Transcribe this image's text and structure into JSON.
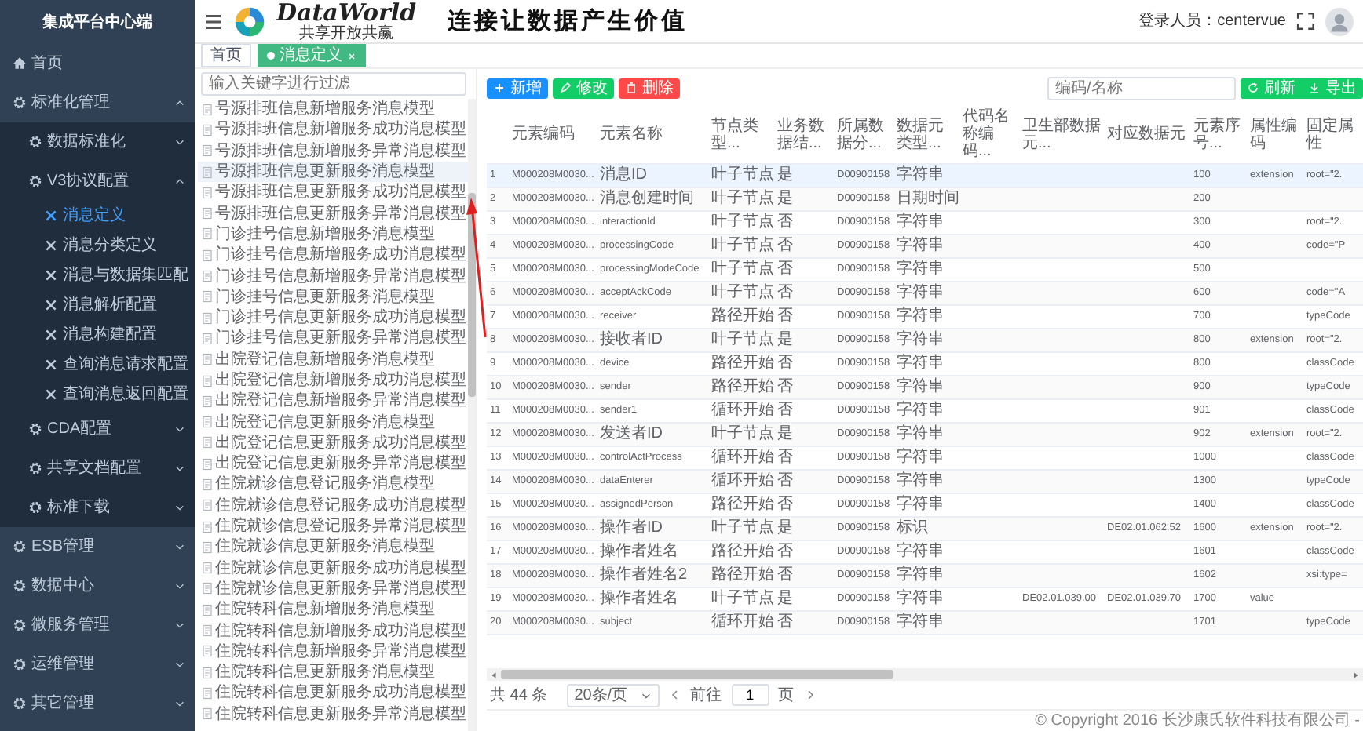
{
  "sidebar": {
    "title": "集成平台中心端",
    "items": [
      {
        "label": "首页",
        "kind": "link"
      },
      {
        "label": "标准化管理",
        "kind": "menu",
        "expanded": true,
        "children": [
          {
            "label": "数据标准化",
            "kind": "menu",
            "expanded": false
          },
          {
            "label": "V3协议配置",
            "kind": "menu",
            "expanded": true,
            "children": [
              {
                "label": "消息定义",
                "kind": "leaf",
                "selected": true
              },
              {
                "label": "消息分类定义",
                "kind": "leaf",
                "selected": false
              },
              {
                "label": "消息与数据集匹配",
                "kind": "leaf",
                "selected": false
              },
              {
                "label": "消息解析配置",
                "kind": "leaf",
                "selected": false
              },
              {
                "label": "消息构建配置",
                "kind": "leaf",
                "selected": false
              },
              {
                "label": "查询消息请求配置",
                "kind": "leaf",
                "selected": false
              },
              {
                "label": "查询消息返回配置",
                "kind": "leaf",
                "selected": false
              }
            ]
          },
          {
            "label": "CDA配置",
            "kind": "menu",
            "expanded": false
          },
          {
            "label": "共享文档配置",
            "kind": "menu",
            "expanded": false
          },
          {
            "label": "标准下载",
            "kind": "menu",
            "expanded": false
          }
        ]
      },
      {
        "label": "ESB管理",
        "kind": "menu",
        "expanded": false
      },
      {
        "label": "数据中心",
        "kind": "menu",
        "expanded": false
      },
      {
        "label": "微服务管理",
        "kind": "menu",
        "expanded": false
      },
      {
        "label": "运维管理",
        "kind": "menu",
        "expanded": false
      },
      {
        "label": "其它管理",
        "kind": "menu",
        "expanded": false
      }
    ]
  },
  "header": {
    "logo_title": "DataWorld",
    "logo_subtitle": "共享开放共赢",
    "slogan": "连接让数据产生价值",
    "user_label": "登录人员：centervue"
  },
  "tabs": [
    {
      "label": "首页",
      "selected": false,
      "closable": false
    },
    {
      "label": "消息定义",
      "selected": true,
      "closable": true
    }
  ],
  "tree": {
    "placeholder": "输入关键字进行过滤",
    "items": [
      {
        "label": "号源排班信息新增服务消息模型",
        "selected": false
      },
      {
        "label": "号源排班信息新增服务成功消息模型",
        "selected": false
      },
      {
        "label": "号源排班信息新增服务异常消息模型",
        "selected": false
      },
      {
        "label": "号源排班信息更新服务消息模型",
        "selected": true
      },
      {
        "label": "号源排班信息更新服务成功消息模型",
        "selected": false
      },
      {
        "label": "号源排班信息更新服务异常消息模型",
        "selected": false
      },
      {
        "label": "门诊挂号信息新增服务消息模型",
        "selected": false
      },
      {
        "label": "门诊挂号信息新增服务成功消息模型",
        "selected": false
      },
      {
        "label": "门诊挂号信息新增服务异常消息模型",
        "selected": false
      },
      {
        "label": "门诊挂号信息更新服务消息模型",
        "selected": false
      },
      {
        "label": "门诊挂号信息更新服务成功消息模型",
        "selected": false
      },
      {
        "label": "门诊挂号信息更新服务异常消息模型",
        "selected": false
      },
      {
        "label": "出院登记信息新增服务消息模型",
        "selected": false
      },
      {
        "label": "出院登记信息新增服务成功消息模型",
        "selected": false
      },
      {
        "label": "出院登记信息新增服务异常消息模型",
        "selected": false
      },
      {
        "label": "出院登记信息更新服务消息模型",
        "selected": false
      },
      {
        "label": "出院登记信息更新服务成功消息模型",
        "selected": false
      },
      {
        "label": "出院登记信息更新服务异常消息模型",
        "selected": false
      },
      {
        "label": "住院就诊信息登记服务消息模型",
        "selected": false
      },
      {
        "label": "住院就诊信息登记服务成功消息模型",
        "selected": false
      },
      {
        "label": "住院就诊信息登记服务异常消息模型",
        "selected": false
      },
      {
        "label": "住院就诊信息更新服务消息模型",
        "selected": false
      },
      {
        "label": "住院就诊信息更新服务成功消息模型",
        "selected": false
      },
      {
        "label": "住院就诊信息更新服务异常消息模型",
        "selected": false
      },
      {
        "label": "住院转科信息新增服务消息模型",
        "selected": false
      },
      {
        "label": "住院转科信息新增服务成功消息模型",
        "selected": false
      },
      {
        "label": "住院转科信息新增服务异常消息模型",
        "selected": false
      },
      {
        "label": "住院转科信息更新服务消息模型",
        "selected": false
      },
      {
        "label": "住院转科信息更新服务成功消息模型",
        "selected": false
      },
      {
        "label": "住院转科信息更新服务异常消息模型",
        "selected": false
      }
    ]
  },
  "toolbar": {
    "buttons": [
      {
        "label": "新增",
        "kind": "add"
      },
      {
        "label": "修改",
        "kind": "edit"
      },
      {
        "label": "删除",
        "kind": "delete"
      }
    ],
    "search": {
      "placeholder": "编码/名称"
    },
    "right_buttons": [
      {
        "label": "刷新",
        "kind": "refresh"
      },
      {
        "label": "导出",
        "kind": "export"
      }
    ]
  },
  "table": {
    "columns": [
      "元素编码",
      "元素名称",
      "节点类型...",
      "业务数据结...",
      "所属数据分...",
      "数据元类型...",
      "代码名称编码...",
      "卫生部数据元...",
      "对应数据元",
      "元素序号...",
      "属性编码",
      "固定属性"
    ],
    "rows": [
      {
        "index": "1",
        "selected": true,
        "cells": [
          "M000208M0030...",
          "消息ID",
          "叶子节点",
          "是",
          "D00900158",
          "字符串",
          null,
          null,
          null,
          "100",
          "extension",
          "root=\"2."
        ]
      },
      {
        "index": "2",
        "selected": false,
        "cells": [
          "M000208M0030...",
          "消息创建时间",
          "叶子节点",
          "是",
          "D00900158",
          "日期时间",
          null,
          null,
          null,
          "200",
          null,
          null
        ]
      },
      {
        "index": "3",
        "selected": false,
        "cells": [
          "M000208M0030...",
          "interactionId",
          "叶子节点",
          "否",
          "D00900158",
          "字符串",
          null,
          null,
          null,
          "300",
          null,
          "root=\"2."
        ]
      },
      {
        "index": "4",
        "selected": false,
        "cells": [
          "M000208M0030...",
          "processingCode",
          "叶子节点",
          "否",
          "D00900158",
          "字符串",
          null,
          null,
          null,
          "400",
          null,
          "code=\"P"
        ]
      },
      {
        "index": "5",
        "selected": false,
        "cells": [
          "M000208M0030...",
          "processingModeCode",
          "叶子节点",
          "否",
          "D00900158",
          "字符串",
          null,
          null,
          null,
          "500",
          null,
          null
        ]
      },
      {
        "index": "6",
        "selected": false,
        "cells": [
          "M000208M0030...",
          "acceptAckCode",
          "叶子节点",
          "否",
          "D00900158",
          "字符串",
          null,
          null,
          null,
          "600",
          null,
          "code=\"A"
        ]
      },
      {
        "index": "7",
        "selected": false,
        "cells": [
          "M000208M0030...",
          "receiver",
          "路径开始",
          "否",
          "D00900158",
          "字符串",
          null,
          null,
          null,
          "700",
          null,
          "typeCode"
        ]
      },
      {
        "index": "8",
        "selected": false,
        "cells": [
          "M000208M0030...",
          "接收者ID",
          "叶子节点",
          "是",
          "D00900158",
          "字符串",
          null,
          null,
          null,
          "800",
          "extension",
          "root=\"2."
        ]
      },
      {
        "index": "9",
        "selected": false,
        "cells": [
          "M000208M0030...",
          "device",
          "路径开始",
          "否",
          "D00900158",
          "字符串",
          null,
          null,
          null,
          "800",
          null,
          "classCode"
        ]
      },
      {
        "index": "10",
        "selected": false,
        "cells": [
          "M000208M0030...",
          "sender",
          "路径开始",
          "否",
          "D00900158",
          "字符串",
          null,
          null,
          null,
          "900",
          null,
          "typeCode"
        ]
      },
      {
        "index": "11",
        "selected": false,
        "cells": [
          "M000208M0030...",
          "sender1",
          "循环开始",
          "否",
          "D00900158",
          "字符串",
          null,
          null,
          null,
          "901",
          null,
          "classCode"
        ]
      },
      {
        "index": "12",
        "selected": false,
        "cells": [
          "M000208M0030...",
          "发送者ID",
          "叶子节点",
          "是",
          "D00900158",
          "字符串",
          null,
          null,
          null,
          "902",
          "extension",
          "root=\"2."
        ]
      },
      {
        "index": "13",
        "selected": false,
        "cells": [
          "M000208M0030...",
          "controlActProcess",
          "循环开始",
          "否",
          "D00900158",
          "字符串",
          null,
          null,
          null,
          "1000",
          null,
          "classCode"
        ]
      },
      {
        "index": "14",
        "selected": false,
        "cells": [
          "M000208M0030...",
          "dataEnterer",
          "循环开始",
          "否",
          "D00900158",
          "字符串",
          null,
          null,
          null,
          "1300",
          null,
          "typeCode"
        ]
      },
      {
        "index": "15",
        "selected": false,
        "cells": [
          "M000208M0030...",
          "assignedPerson",
          "路径开始",
          "否",
          "D00900158",
          "字符串",
          null,
          null,
          null,
          "1400",
          null,
          "classCode"
        ]
      },
      {
        "index": "16",
        "selected": false,
        "cells": [
          "M000208M0030...",
          "操作者ID",
          "叶子节点",
          "是",
          "D00900158",
          "标识",
          null,
          null,
          "DE02.01.062.52",
          "1600",
          "extension",
          "root=\"2."
        ]
      },
      {
        "index": "17",
        "selected": false,
        "cells": [
          "M000208M0030...",
          "操作者姓名",
          "路径开始",
          "否",
          "D00900158",
          "字符串",
          null,
          null,
          null,
          "1601",
          null,
          "classCode"
        ]
      },
      {
        "index": "18",
        "selected": false,
        "cells": [
          "M000208M0030...",
          "操作者姓名2",
          "路径开始",
          "否",
          "D00900158",
          "字符串",
          null,
          null,
          null,
          "1602",
          null,
          "xsi:type="
        ]
      },
      {
        "index": "19",
        "selected": false,
        "cells": [
          "M000208M0030...",
          "操作者姓名",
          "叶子节点",
          "是",
          "D00900158",
          "字符串",
          null,
          "DE02.01.039.00",
          "DE02.01.039.70",
          "1700",
          "value",
          null
        ]
      },
      {
        "index": "20",
        "selected": false,
        "cells": [
          "M000208M0030...",
          "subject",
          "循环开始",
          "否",
          "D00900158",
          "字符串",
          null,
          null,
          null,
          "1701",
          null,
          "typeCode"
        ]
      }
    ]
  },
  "pagination": {
    "total": "共 44 条",
    "page_size": "20条/页",
    "goto_label": "前往",
    "page": "1",
    "page_suffix": "页"
  },
  "footer": "© Copyright 2016 长沙康氏软件科技有限公司 -"
}
